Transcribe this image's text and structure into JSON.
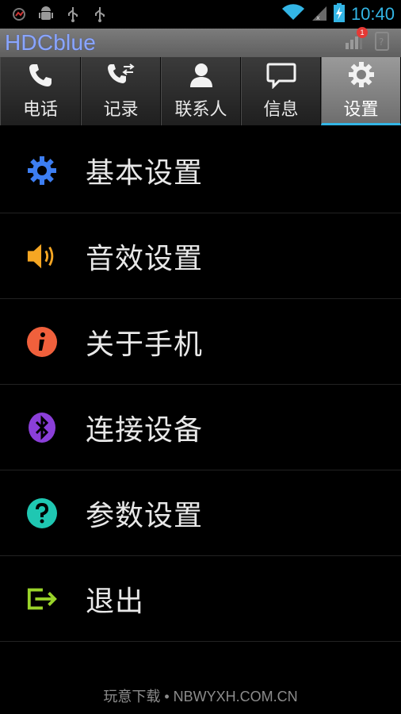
{
  "status_bar": {
    "time": "10:40",
    "icons": [
      "android-debug-icon",
      "android-icon",
      "usb-icon",
      "usb-icon",
      "wifi-icon",
      "signal-icon",
      "battery-charging-icon"
    ],
    "accent_color": "#33b5e5"
  },
  "app": {
    "title": "HDCblue",
    "notification_count": "1"
  },
  "tabs": [
    {
      "label": "电话",
      "icon": "phone-icon"
    },
    {
      "label": "记录",
      "icon": "call-log-icon"
    },
    {
      "label": "联系人",
      "icon": "contacts-icon"
    },
    {
      "label": "信息",
      "icon": "message-icon"
    },
    {
      "label": "设置",
      "icon": "settings-icon",
      "active": true
    }
  ],
  "menu": [
    {
      "label": "基本设置",
      "icon": "gear-icon",
      "color": "#3d7ef2"
    },
    {
      "label": "音效设置",
      "icon": "speaker-icon",
      "color": "#f5a623"
    },
    {
      "label": "关于手机",
      "icon": "info-icon",
      "color": "#f0603c"
    },
    {
      "label": "连接设备",
      "icon": "bluetooth-icon",
      "color": "#8b3fd9"
    },
    {
      "label": "参数设置",
      "icon": "help-icon",
      "color": "#1fc7b2"
    },
    {
      "label": "退出",
      "icon": "exit-icon",
      "color": "#9ad42a"
    }
  ],
  "footer": {
    "watermark": "玩意下载 • NBWYXH.COM.CN"
  }
}
